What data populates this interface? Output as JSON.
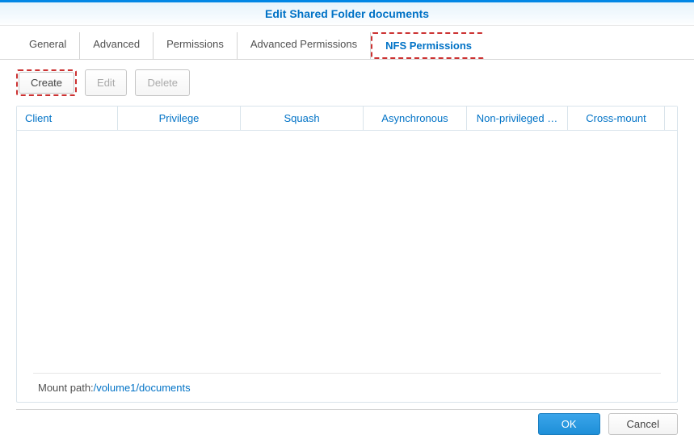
{
  "header": {
    "title": "Edit Shared Folder documents"
  },
  "tabs": {
    "general": "General",
    "advanced": "Advanced",
    "permissions": "Permissions",
    "advanced_permissions": "Advanced Permissions",
    "nfs_permissions": "NFS Permissions"
  },
  "toolbar": {
    "create": "Create",
    "edit": "Edit",
    "delete": "Delete"
  },
  "table": {
    "columns": {
      "client": "Client",
      "privilege": "Privilege",
      "squash": "Squash",
      "asynchronous": "Asynchronous",
      "non_privileged": "Non-privileged …",
      "cross_mount": "Cross-mount"
    }
  },
  "mount": {
    "label": "Mount path:",
    "path": "/volume1/documents"
  },
  "buttons": {
    "ok": "OK",
    "cancel": "Cancel"
  }
}
